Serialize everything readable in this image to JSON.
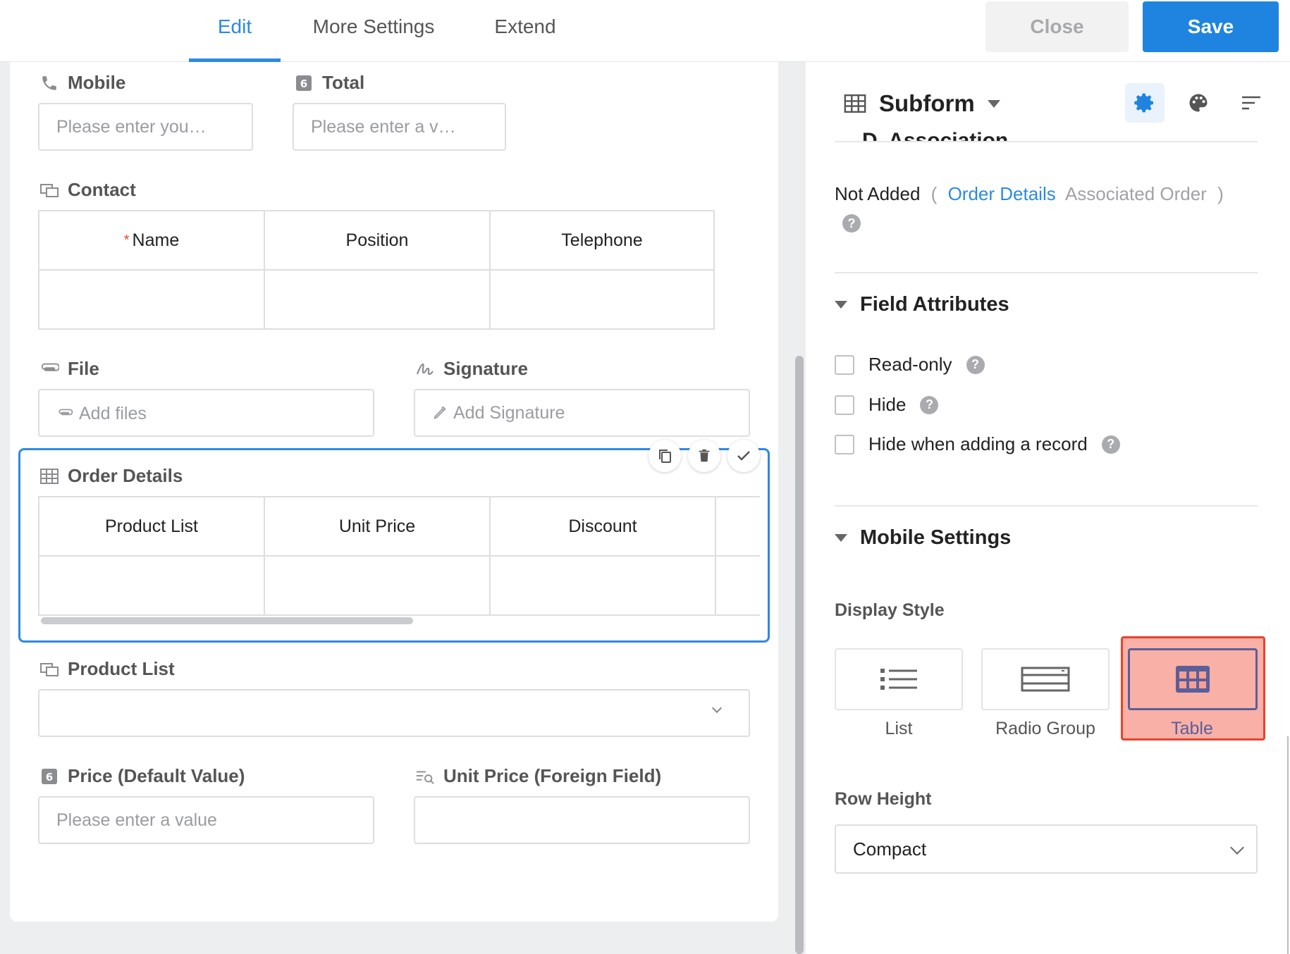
{
  "tabs": [
    {
      "label": "Edit",
      "active": true
    },
    {
      "label": "More Settings",
      "active": false
    },
    {
      "label": "Extend",
      "active": false
    }
  ],
  "buttons": {
    "close": "Close",
    "save": "Save"
  },
  "form": {
    "mobile": {
      "label": "Mobile",
      "placeholder": "Please enter you…"
    },
    "total": {
      "label": "Total",
      "placeholder": "Please enter a v…"
    },
    "contact": {
      "label": "Contact",
      "required_mark": "*",
      "columns": [
        "Name",
        "Position",
        "Telephone"
      ]
    },
    "file": {
      "label": "File",
      "placeholder": "Add files"
    },
    "signature": {
      "label": "Signature",
      "placeholder": "Add Signature"
    },
    "order_details": {
      "label": "Order Details",
      "columns": [
        "Product List",
        "Unit Price",
        "Discount"
      ]
    },
    "product_list": {
      "label": "Product List",
      "value": ""
    },
    "price": {
      "label": "Price (Default Value)",
      "placeholder": "Please enter a value"
    },
    "unit_price": {
      "label": "Unit Price (Foreign Field)",
      "value": ""
    }
  },
  "panel": {
    "title": "Subform",
    "partial_heading": "D. Association",
    "association": {
      "status": "Not Added",
      "open": "(",
      "link": "Order Details",
      "target": "Associated Order",
      "close": ")"
    },
    "field_attributes": {
      "title": "Field Attributes",
      "options": [
        {
          "label": "Read-only",
          "checked": false
        },
        {
          "label": "Hide",
          "checked": false
        },
        {
          "label": "Hide when adding a record",
          "checked": false
        }
      ]
    },
    "mobile_settings": {
      "title": "Mobile Settings",
      "display_style_label": "Display Style",
      "display_styles": [
        "List",
        "Radio Group",
        "Table"
      ],
      "selected_style": "Table",
      "row_height_label": "Row Height",
      "row_height_value": "Compact"
    }
  },
  "colors": {
    "accent": "#2d8ae0",
    "save": "#1f84e0",
    "highlight": "#e4452e"
  }
}
